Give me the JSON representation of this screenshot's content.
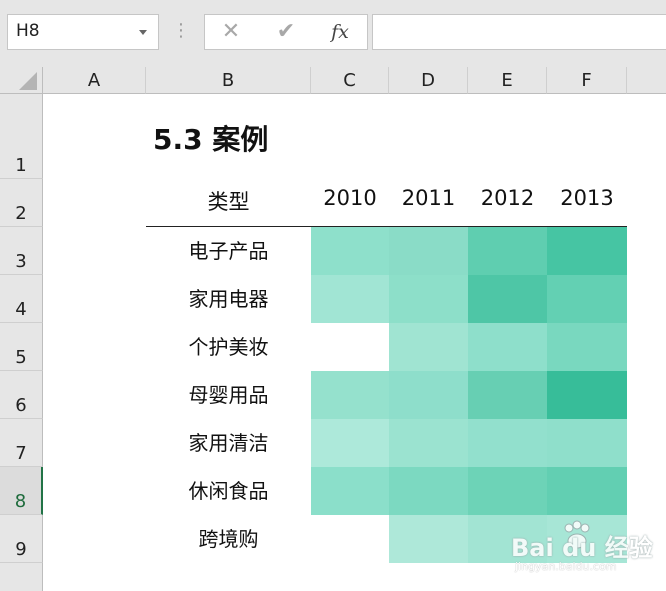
{
  "formula_bar": {
    "name_box": "H8",
    "separator": "⋮",
    "cancel_icon": "✕",
    "enter_icon": "✔",
    "fx_label": "fx",
    "formula": ""
  },
  "columns": [
    "A",
    "B",
    "C",
    "D",
    "E",
    "F"
  ],
  "rows": [
    "1",
    "2",
    "3",
    "4",
    "5",
    "6",
    "7",
    "8",
    "9"
  ],
  "active_row": "8",
  "sheet": {
    "title": "5.3 案例",
    "header": {
      "type_label": "类型",
      "years": [
        "2010",
        "2011",
        "2012",
        "2013"
      ]
    },
    "categories": [
      "电子产品",
      "家用电器",
      "个护美妆",
      "母婴用品",
      "家用清洁",
      "休闲食品",
      "跨境购"
    ],
    "heatmap": [
      [
        "#8ee0cb",
        "#8adcc7",
        "#5fceb0",
        "#46c5a3"
      ],
      [
        "#a1e5d4",
        "#8ddfc9",
        "#4ec6a6",
        "#63d0b3"
      ],
      [
        "#ffffff",
        "#a0e4d2",
        "#8edfcb",
        "#79d8bf"
      ],
      [
        "#95e1cd",
        "#8edecb",
        "#67cfb3",
        "#37bd99"
      ],
      [
        "#ade9da",
        "#9be3d0",
        "#92e0cd",
        "#8fdfcb"
      ],
      [
        "#8bdfca",
        "#7cd9c1",
        "#6dd3b7",
        "#62cfb2"
      ],
      [
        "#ffffff",
        "#aee8d9",
        "#a2e4d3",
        "#a7e6d6"
      ]
    ]
  },
  "watermark": {
    "logo_text": "Bai du 经验",
    "sub_text": "jingyan.baidu.com"
  }
}
